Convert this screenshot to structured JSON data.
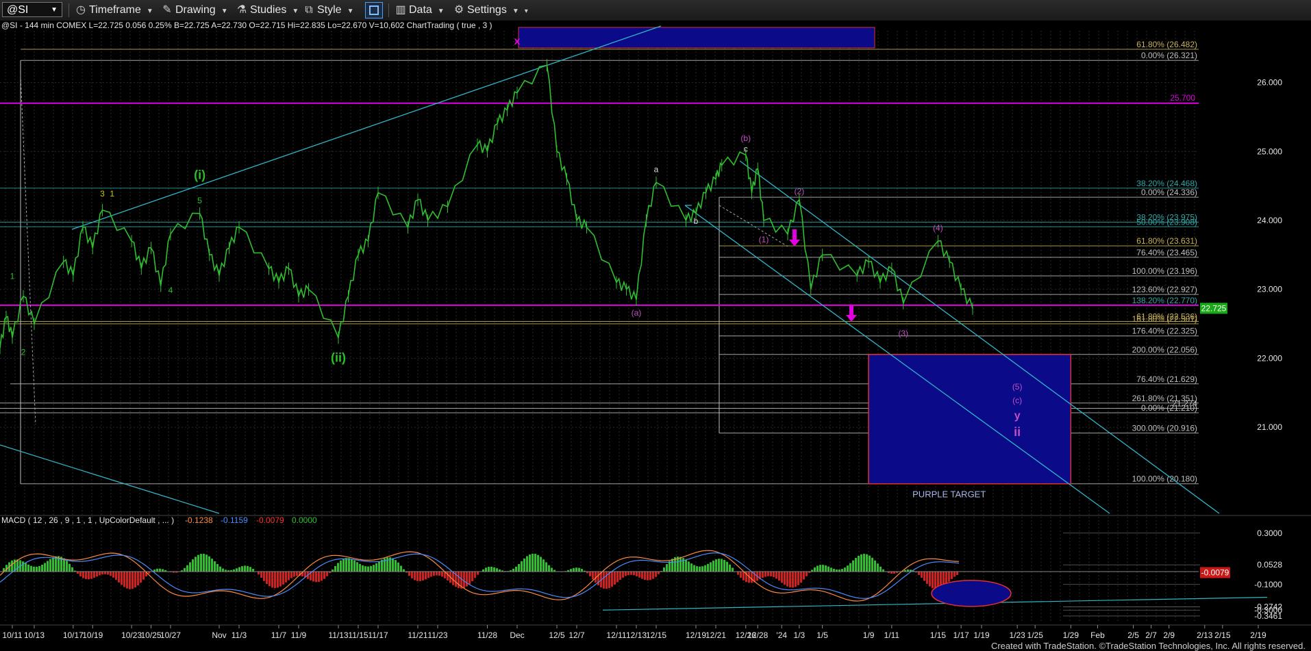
{
  "toolbar": {
    "symbol": "@SI",
    "timeframe": "Timeframe",
    "drawing": "Drawing",
    "studies": "Studies",
    "style": "Style",
    "data": "Data",
    "settings": "Settings"
  },
  "chart_data": {
    "type": "line",
    "header": "@SI - 144 min  COMEX  L=22.725  0.056  0.25%  B=22.725  A=22.730  O=22.715  Hi=22.835  Lo=22.670  V=10,602  ChartTrading ( true , 3 )",
    "price_axis": {
      "ylim": [
        19.8,
        26.8
      ],
      "ticks": [
        "26.000",
        "25.000",
        "24.000",
        "23.000",
        "22.000",
        "21.000"
      ]
    },
    "x_tick_labels": [
      "10/11",
      "10/13",
      "10/17",
      "10/19",
      "10/23",
      "10/25",
      "10/27",
      "Nov",
      "11/3",
      "11/7",
      "11/9",
      "11/13",
      "11/15",
      "11/17",
      "11/21",
      "11/23",
      "11/28",
      "Dec",
      "12/5",
      "12/7",
      "12/11",
      "12/13",
      "12/15",
      "12/19",
      "12/21",
      "12/26",
      "12/28",
      "'24",
      "1/3",
      "1/5",
      "1/9",
      "1/11",
      "1/15",
      "1/17",
      "1/19",
      "1/23",
      "1/25",
      "1/29",
      "Feb",
      "2/5",
      "2/7",
      "2/9",
      "2/13",
      "2/15",
      "2/19"
    ],
    "price_series": [
      {
        "x": "10/9",
        "y": 22.15
      },
      {
        "x": "10/10",
        "y": 22.6
      },
      {
        "x": "10/11",
        "y": 22.3
      },
      {
        "x": "10/12",
        "y": 22.9
      },
      {
        "x": "10/13",
        "y": 22.5
      },
      {
        "x": "10/16",
        "y": 23.4
      },
      {
        "x": "10/17",
        "y": 23.2
      },
      {
        "x": "10/18",
        "y": 23.9
      },
      {
        "x": "10/19",
        "y": 23.6
      },
      {
        "x": "10/20",
        "y": 24.15
      },
      {
        "x": "10/23",
        "y": 23.7
      },
      {
        "x": "10/24",
        "y": 23.3
      },
      {
        "x": "10/25",
        "y": 23.6
      },
      {
        "x": "10/26",
        "y": 23.05
      },
      {
        "x": "10/27",
        "y": 23.8
      },
      {
        "x": "10/30",
        "y": 24.1
      },
      {
        "x": "10/31",
        "y": 23.5
      },
      {
        "x": "11/1",
        "y": 23.2
      },
      {
        "x": "11/2",
        "y": 23.6
      },
      {
        "x": "11/3",
        "y": 23.9
      },
      {
        "x": "11/6",
        "y": 23.3
      },
      {
        "x": "11/7",
        "y": 23.1
      },
      {
        "x": "11/8",
        "y": 23.3
      },
      {
        "x": "11/9",
        "y": 22.9
      },
      {
        "x": "11/10",
        "y": 23.0
      },
      {
        "x": "11/13",
        "y": 22.3
      },
      {
        "x": "11/14",
        "y": 22.9
      },
      {
        "x": "11/15",
        "y": 23.5
      },
      {
        "x": "11/16",
        "y": 23.7
      },
      {
        "x": "11/17",
        "y": 24.4
      },
      {
        "x": "11/20",
        "y": 23.9
      },
      {
        "x": "11/21",
        "y": 24.3
      },
      {
        "x": "11/22",
        "y": 24.0
      },
      {
        "x": "11/24",
        "y": 24.2
      },
      {
        "x": "11/27",
        "y": 25.1
      },
      {
        "x": "11/28",
        "y": 25.0
      },
      {
        "x": "11/29",
        "y": 25.4
      },
      {
        "x": "11/30",
        "y": 25.6
      },
      {
        "x": "12/1",
        "y": 25.85
      },
      {
        "x": "12/4",
        "y": 26.25
      },
      {
        "x": "12/5",
        "y": 25.0
      },
      {
        "x": "12/6",
        "y": 24.6
      },
      {
        "x": "12/7",
        "y": 24.0
      },
      {
        "x": "12/8",
        "y": 23.9
      },
      {
        "x": "12/11",
        "y": 23.1
      },
      {
        "x": "12/12",
        "y": 23.0
      },
      {
        "x": "12/13",
        "y": 22.85
      },
      {
        "x": "12/14",
        "y": 24.0
      },
      {
        "x": "12/15",
        "y": 24.55
      },
      {
        "x": "12/18",
        "y": 24.0
      },
      {
        "x": "12/19",
        "y": 24.1
      },
      {
        "x": "12/20",
        "y": 24.4
      },
      {
        "x": "12/21",
        "y": 24.6
      },
      {
        "x": "12/22",
        "y": 24.8
      },
      {
        "x": "12/26",
        "y": 24.95
      },
      {
        "x": "12/27",
        "y": 24.4
      },
      {
        "x": "12/28",
        "y": 24.75
      },
      {
        "x": "12/29",
        "y": 24.0
      },
      {
        "x": "1/2",
        "y": 23.8
      },
      {
        "x": "1/3",
        "y": 24.3
      },
      {
        "x": "1/4",
        "y": 23.0
      },
      {
        "x": "1/5",
        "y": 23.5
      },
      {
        "x": "1/8",
        "y": 23.2
      },
      {
        "x": "1/9",
        "y": 23.4
      },
      {
        "x": "1/10",
        "y": 23.1
      },
      {
        "x": "1/11",
        "y": 23.3
      },
      {
        "x": "1/12",
        "y": 22.8
      },
      {
        "x": "1/15",
        "y": 23.7
      },
      {
        "x": "1/16",
        "y": 23.4
      },
      {
        "x": "1/17",
        "y": 23.0
      },
      {
        "x": "1/18",
        "y": 22.72
      }
    ],
    "current_price": "22.725",
    "horizontal_levels": [
      {
        "y": 26.321,
        "label": "0.00% (26.321)"
      },
      {
        "y": 26.482,
        "label": "61.80% (26.482)",
        "color": "#c8b35a"
      },
      {
        "y": 24.468,
        "label": "38.20% (24.468)",
        "color": "#2fa6a6"
      },
      {
        "y": 24.336,
        "label": "0.00% (24.336)"
      },
      {
        "y": 23.975,
        "label": "38.20% (23.975)",
        "color": "#2fa6a6"
      },
      {
        "y": 23.908,
        "label": "50.00% (23.908)",
        "color": "#2fa6a6"
      },
      {
        "y": 23.631,
        "label": "61.80% (23.631)",
        "color": "#c8b35a"
      },
      {
        "y": 23.465,
        "label": "76.40% (23.465)"
      },
      {
        "y": 23.196,
        "label": "100.00% (23.196)"
      },
      {
        "y": 22.927,
        "label": "123.60% (22.927)"
      },
      {
        "y": 22.77,
        "label": "138.20% (22.770)",
        "color": "#2fa6a6"
      },
      {
        "y": 22.536,
        "label": "61.80% (22.536)",
        "color": "#c8b35a"
      },
      {
        "y": 22.501,
        "label": "161.80% (22.501)",
        "color": "#c8b35a"
      },
      {
        "y": 22.325,
        "label": "176.40% (22.325)"
      },
      {
        "y": 22.056,
        "label": "200.00% (22.056)"
      },
      {
        "y": 21.629,
        "label": "76.40% (21.629)"
      },
      {
        "y": 21.351,
        "label": "261.80% (21.351)"
      },
      {
        "y": 21.274,
        "label": "21.274"
      },
      {
        "y": 21.21,
        "label": "0.00% (21.210)"
      },
      {
        "y": 20.916,
        "label": "300.00% (20.916)"
      },
      {
        "y": 20.18,
        "label": "100.00% (20.180)"
      }
    ],
    "magenta_levels": [
      {
        "y": 25.7,
        "label": "25.700"
      },
      {
        "y": 22.77,
        "label": "22.770"
      }
    ],
    "purple_target": {
      "label": "PURPLE TARGET",
      "y_top": 22.056,
      "y_bottom": 20.18,
      "x_start": "1/9",
      "x_end": "1/29"
    },
    "wave_labels": [
      {
        "text": "(i)",
        "x": "10/30",
        "y": 24.6,
        "color": "#27c127",
        "size": 18
      },
      {
        "text": "(ii)",
        "x": "11/13",
        "y": 21.95,
        "color": "#27c127",
        "size": 18
      },
      {
        "text": "1",
        "x": "10/11",
        "y": 23.15,
        "color": "#27c127",
        "size": 12
      },
      {
        "text": "2",
        "x": "10/12",
        "y": 22.05,
        "color": "#27c127",
        "size": 12
      },
      {
        "text": "3",
        "x": "10/20",
        "y": 24.35,
        "color": "#c8c800",
        "size": 12
      },
      {
        "text": "1",
        "x": "10/21",
        "y": 24.35,
        "color": "#c8c800",
        "size": 12
      },
      {
        "text": "4",
        "x": "10/27",
        "y": 22.95,
        "color": "#27c127",
        "size": 12
      },
      {
        "text": "5",
        "x": "10/30",
        "y": 24.25,
        "color": "#27c127",
        "size": 12
      },
      {
        "text": "x",
        "x": "12/1",
        "y": 26.55,
        "color": "#e000e0",
        "size": 16
      },
      {
        "text": "a",
        "x": "12/15",
        "y": 24.7,
        "color": "#dddddd",
        "size": 12
      },
      {
        "text": "b",
        "x": "12/19",
        "y": 23.95,
        "color": "#dddddd",
        "size": 12
      },
      {
        "text": "c",
        "x": "12/26",
        "y": 25.0,
        "color": "#dddddd",
        "size": 12
      },
      {
        "text": "(b)",
        "x": "12/26",
        "y": 25.15,
        "color": "#c24fc2",
        "size": 12
      },
      {
        "text": "(a)",
        "x": "12/13",
        "y": 22.62,
        "color": "#c24fc2",
        "size": 12
      },
      {
        "text": "(2)",
        "x": "1/3",
        "y": 24.38,
        "color": "#c24fc2",
        "size": 12
      },
      {
        "text": "(1)",
        "x": "12/29",
        "y": 23.68,
        "color": "#c24fc2",
        "size": 12
      },
      {
        "text": "(3)",
        "x": "1/12",
        "y": 22.32,
        "color": "#c24fc2",
        "size": 12
      },
      {
        "text": "(4)",
        "x": "1/15",
        "y": 23.85,
        "color": "#c24fc2",
        "size": 12
      },
      {
        "text": "(5)",
        "x": "1/23",
        "y": 21.55,
        "color": "#c24fc2",
        "size": 12
      },
      {
        "text": "(c)",
        "x": "1/23",
        "y": 21.35,
        "color": "#c24fc2",
        "size": 12
      },
      {
        "text": "y",
        "x": "1/23",
        "y": 21.12,
        "color": "#c24fc2",
        "size": 16
      },
      {
        "text": "ii",
        "x": "1/23",
        "y": 20.87,
        "color": "#c24fc2",
        "size": 18
      }
    ],
    "macd": {
      "label": "MACD ( 12 , 26 , 9 , 1 , 1 , UpColorDefault , ... )",
      "values": [
        "-0.1238",
        "-0.1159",
        "-0.0079",
        "0.0000"
      ],
      "axis_ticks": [
        "0.3000",
        "0.0528",
        "-0.1000",
        "-0.2742",
        "-0.3000",
        "-0.3461"
      ],
      "current": "-0.0079",
      "ylim": [
        -0.4,
        0.4
      ]
    },
    "footer": "Created with TradeStation. ©TradeStation Technologies, Inc. All rights reserved."
  }
}
